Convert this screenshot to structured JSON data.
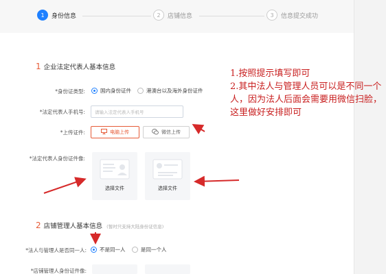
{
  "steps": [
    {
      "num": "1",
      "label": "身份信息",
      "active": true
    },
    {
      "num": "2",
      "label": "店铺信息",
      "active": false
    },
    {
      "num": "3",
      "label": "信息提交成功",
      "active": false
    }
  ],
  "section1": {
    "index": "1",
    "title": "企业法定代表人基本信息",
    "id_type_label": "*身份证类型:",
    "id_type_options": [
      "国内身份证件",
      "港澳台以及海外身份证件"
    ],
    "phone_label": "*法定代表人手机号:",
    "phone_placeholder": "请输入法定代表人手机号",
    "upload_label": "*上传证件:",
    "upload_pc": "电脑上传",
    "upload_wechat": "微信上传",
    "id_photo_label": "*法定代表人身份证件像:",
    "choose_file_1": "选择文件",
    "choose_file_2": "选择文件"
  },
  "section2": {
    "index": "2",
    "title": "店铺管理人基本信息",
    "note": "(暂时只支持大陆身份证信息)",
    "same_person_label": "*法人与管理人是否同一人:",
    "same_options": [
      "不是同一人",
      "是同一个人"
    ],
    "manager_id_label": "*店铺管理人身份证件像:"
  },
  "annotation": {
    "line1": "1.按照提示填写即可",
    "line2": "2.其中法人与管理人员可以是不同一个人，因为法人后面会需要用微信扫脸，这里做好安排即可"
  },
  "colors": {
    "accent_blue": "#1e80ff",
    "accent_orange": "#e65a36",
    "annotation_red": "#c81e1e"
  }
}
